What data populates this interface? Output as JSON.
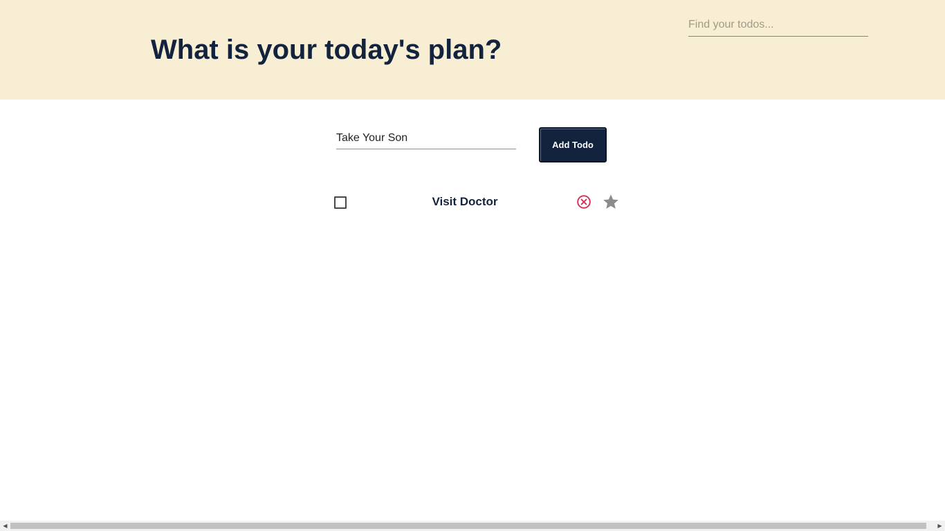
{
  "header": {
    "title": "What is your today's plan?",
    "search": {
      "placeholder": "Find your todos...",
      "value": ""
    },
    "background_color": "#f8eed4"
  },
  "new_todo": {
    "value": "Take Your Son",
    "placeholder": "",
    "add_button_label": "Add Todo"
  },
  "todos": [
    {
      "text": "Visit Doctor",
      "completed": false,
      "starred": false,
      "delete_icon": "close-circle-icon",
      "star_icon": "star-icon"
    }
  ],
  "colors": {
    "primary": "#13233e",
    "delete": "#d0385c",
    "star": "#8c8c8c"
  }
}
